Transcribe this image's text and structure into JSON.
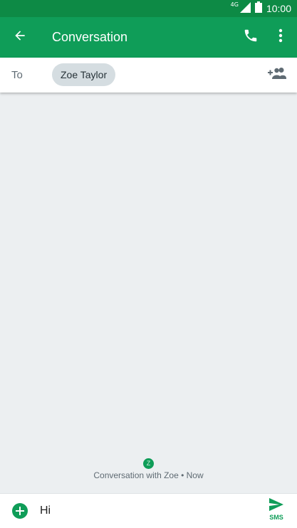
{
  "status_bar": {
    "network_type": "4G",
    "time": "10:00",
    "icons": [
      "signal-icon",
      "battery-icon"
    ]
  },
  "app_bar": {
    "title": "Conversation",
    "icons": [
      "back-arrow-icon",
      "phone-icon",
      "more-vert-icon"
    ]
  },
  "recipients": {
    "to_label": "To",
    "chips": [
      {
        "name": "Zoe Taylor"
      }
    ],
    "add_icon": "add-person-icon"
  },
  "conversation": {
    "avatar_letter": "Z",
    "caption": "Conversation with Zoe • Now"
  },
  "compose": {
    "message_value": "Hi",
    "send_label": "SMS",
    "icons": [
      "add-circle-icon",
      "send-icon"
    ]
  },
  "colors": {
    "status_bar": "#0d8a45",
    "app_bar": "#0f9d58",
    "accent": "#0f9d58",
    "background": "#eceff1",
    "chip": "#d5dde1"
  }
}
